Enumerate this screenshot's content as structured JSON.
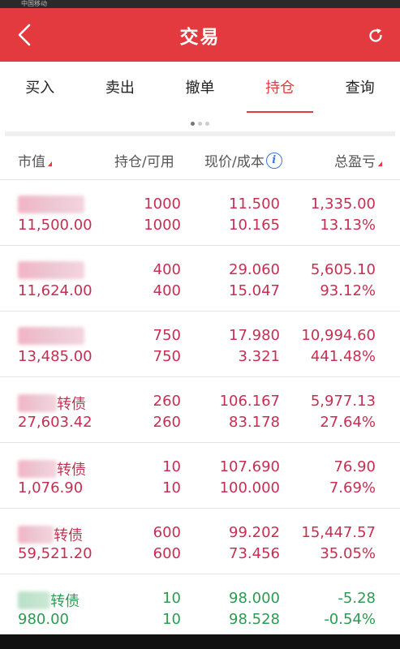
{
  "statusbar": {
    "carrier": "中国移动"
  },
  "header": {
    "title": "交易",
    "back_icon": "chevron-left-icon",
    "refresh_icon": "refresh-icon",
    "bg_color": "#e23a3e"
  },
  "tabs": [
    {
      "label": "买入",
      "active": false
    },
    {
      "label": "卖出",
      "active": false
    },
    {
      "label": "撤单",
      "active": false
    },
    {
      "label": "持仓",
      "active": true
    },
    {
      "label": "查询",
      "active": false
    }
  ],
  "pager": {
    "pages": 3,
    "current": 1
  },
  "columns": {
    "market_value": "市值",
    "position_available": "持仓/可用",
    "price_cost": "现价/成本",
    "total_pl": "总盈亏"
  },
  "holdings": [
    {
      "name_suffix": "",
      "market_value": "11,500.00",
      "position": "1000",
      "available": "1000",
      "price": "11.500",
      "cost": "10.165",
      "pl": "1,335.00",
      "pl_pct": "13.13%",
      "trend": "up"
    },
    {
      "name_suffix": "",
      "market_value": "11,624.00",
      "position": "400",
      "available": "400",
      "price": "29.060",
      "cost": "15.047",
      "pl": "5,605.10",
      "pl_pct": "93.12%",
      "trend": "up"
    },
    {
      "name_suffix": "",
      "market_value": "13,485.00",
      "position": "750",
      "available": "750",
      "price": "17.980",
      "cost": "3.321",
      "pl": "10,994.60",
      "pl_pct": "441.48%",
      "trend": "up"
    },
    {
      "name_suffix": "转债",
      "market_value": "27,603.42",
      "position": "260",
      "available": "260",
      "price": "106.167",
      "cost": "83.178",
      "pl": "5,977.13",
      "pl_pct": "27.64%",
      "trend": "up"
    },
    {
      "name_suffix": "转债",
      "market_value": "1,076.90",
      "position": "10",
      "available": "10",
      "price": "107.690",
      "cost": "100.000",
      "pl": "76.90",
      "pl_pct": "7.69%",
      "trend": "up"
    },
    {
      "name_suffix": "转债",
      "market_value": "59,521.20",
      "position": "600",
      "available": "600",
      "price": "99.202",
      "cost": "73.456",
      "pl": "15,447.57",
      "pl_pct": "35.05%",
      "trend": "up"
    },
    {
      "name_suffix": "转债",
      "market_value": "980.00",
      "position": "10",
      "available": "10",
      "price": "98.000",
      "cost": "98.528",
      "pl": "-5.28",
      "pl_pct": "-0.54%",
      "trend": "down"
    }
  ],
  "colors": {
    "up": "#c52f52",
    "down": "#2e9a52",
    "accent": "#e23a3e",
    "info": "#3a78d8"
  }
}
